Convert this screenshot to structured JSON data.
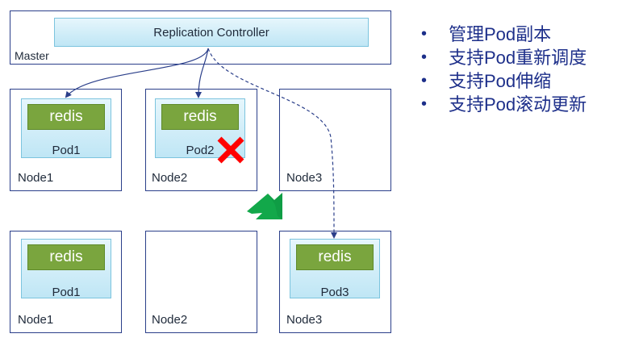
{
  "master": {
    "label": "Master",
    "controller_label": "Replication Controller"
  },
  "before": {
    "nodes": [
      {
        "label": "Node1",
        "pod": {
          "app": "redis",
          "label": "Pod1"
        }
      },
      {
        "label": "Node2",
        "pod": {
          "app": "redis",
          "label": "Pod2",
          "status": "failed"
        }
      },
      {
        "label": "Node3"
      }
    ]
  },
  "after": {
    "nodes": [
      {
        "label": "Node1",
        "pod": {
          "app": "redis",
          "label": "Pod1"
        }
      },
      {
        "label": "Node2"
      },
      {
        "label": "Node3",
        "pod": {
          "app": "redis",
          "label": "Pod3"
        }
      }
    ]
  },
  "features": [
    "管理Pod副本",
    "支持Pod重新调度",
    "支持Pod伸缩",
    "支持Pod滚动更新"
  ],
  "colors": {
    "border": "#2b3f8a",
    "pod_fill": "#bfe6f5",
    "redis_fill": "#7aa53e",
    "failure_cross": "#ff0000",
    "transition_arrow": "#12a84a",
    "bullet_text": "#1d2f8a"
  },
  "icons": {
    "failure": "cross-icon",
    "transition": "down-arrow-icon"
  }
}
